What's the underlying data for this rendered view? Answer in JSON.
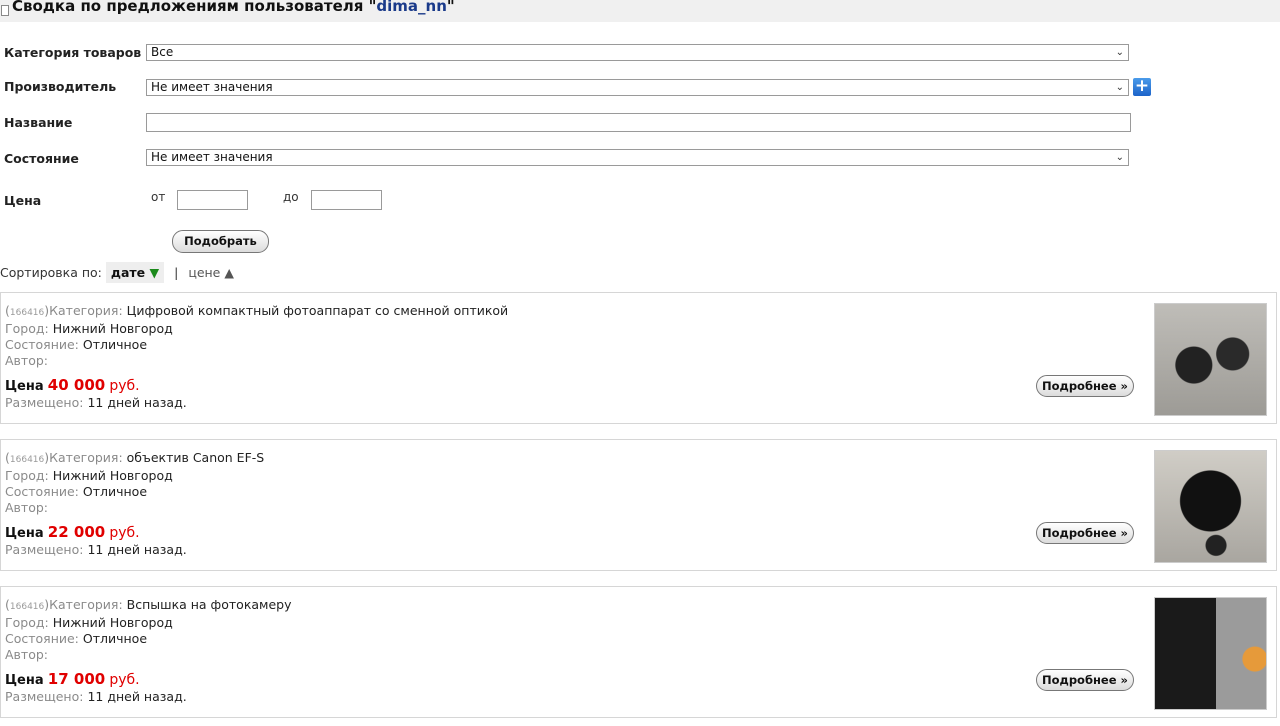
{
  "header": {
    "title_prefix": "Сводка по предложениям пользователя \"",
    "username": "dima_nn",
    "title_suffix": "\""
  },
  "filters": {
    "category": {
      "label": "Категория товаров",
      "value": "Все"
    },
    "manufacturer": {
      "label": "Производитель",
      "value": "Не имеет значения"
    },
    "name": {
      "label": "Название",
      "value": ""
    },
    "condition": {
      "label": "Состояние",
      "value": "Не имеет значения"
    },
    "price": {
      "label": "Цена",
      "from_label": "от",
      "to_label": "до",
      "from_value": "",
      "to_value": ""
    },
    "submit_label": "Подобрать"
  },
  "sort": {
    "label": "Сортировка по:",
    "active": "дате",
    "active_arrow": "▼",
    "separator": "|",
    "other": "цене",
    "other_arrow": "▲"
  },
  "listing_labels": {
    "category": "Категория:",
    "city": "Город:",
    "condition": "Состояние:",
    "author": "Автор:",
    "price": "Цена",
    "currency": "руб.",
    "posted": "Размещено:",
    "more_button": "Подробнее »"
  },
  "listings": [
    {
      "id": "166416",
      "category": "Цифровой компактный фотоаппарат со сменной оптикой",
      "city": "Нижний Новгород",
      "condition": "Отличное",
      "author": "",
      "price": "40 000",
      "posted": "11 дней назад."
    },
    {
      "id": "166416",
      "category": "объектив Canon EF-S",
      "city": "Нижний Новгород",
      "condition": "Отличное",
      "author": "",
      "price": "22 000",
      "posted": "11 дней назад."
    },
    {
      "id": "166416",
      "category": "Вспышка на фотокамеру",
      "city": "Нижний Новгород",
      "condition": "Отличное",
      "author": "",
      "price": "17 000",
      "posted": "11 дней назад."
    }
  ],
  "colors": {
    "price": "#e00000",
    "username": "#1a3a8a",
    "sort_arrow_active": "#1b8a1b",
    "plus_button": "#1c63c9"
  },
  "icons": {
    "header": "document-icon",
    "add": "plus-icon",
    "dropdown": "chevron-down-icon"
  }
}
